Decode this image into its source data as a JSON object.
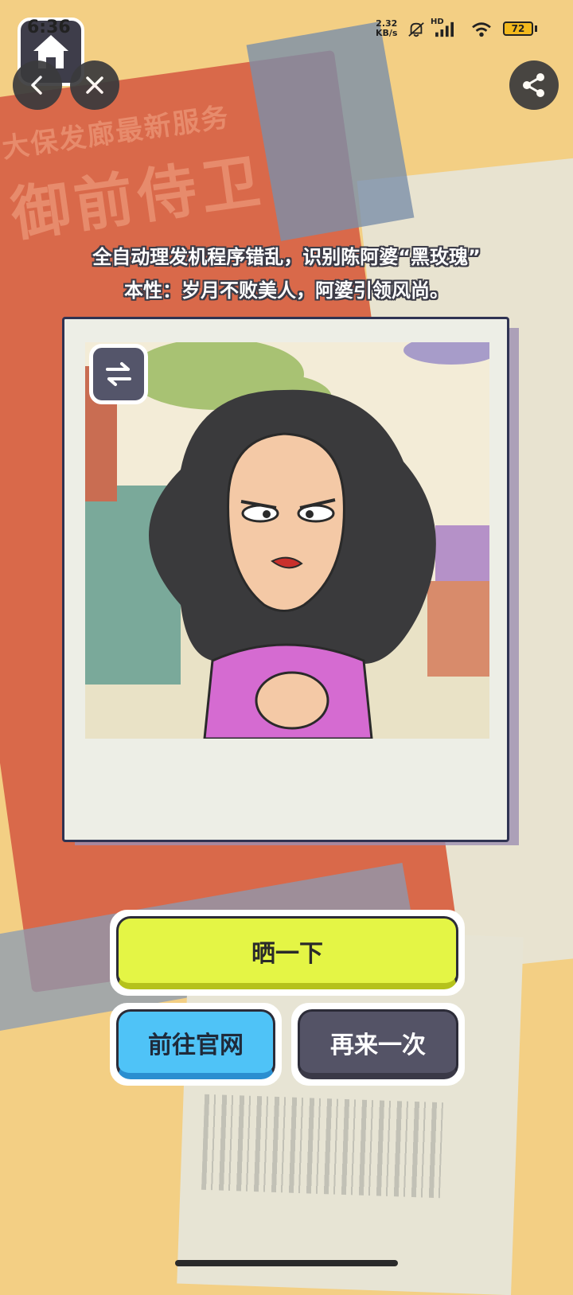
{
  "status_bar": {
    "time": "6:36",
    "net_speed_value": "2.32",
    "net_speed_unit": "KB/s",
    "signal_label": "HD",
    "battery": "72"
  },
  "background": {
    "poster_small": "大保发廊最新服务",
    "poster_big": "御前侍卫"
  },
  "description": {
    "line1": "全自动理发机程序错乱，识别陈阿婆“黑玫瑰”",
    "line2": "本性：岁月不败美人，阿婆引领风尚。"
  },
  "buttons": {
    "share": "晒一下",
    "official_site": "前往官网",
    "try_again": "再来一次"
  },
  "icons": {
    "home": "home-icon",
    "back": "chevron-left-icon",
    "close": "close-icon",
    "share": "share-icon",
    "swap": "swap-arrows-icon"
  },
  "colors": {
    "background": "#f3cf84",
    "poster_red": "#d9694a",
    "share_button": "#e4f545",
    "site_button": "#4fc3f7",
    "again_button": "#545366"
  }
}
